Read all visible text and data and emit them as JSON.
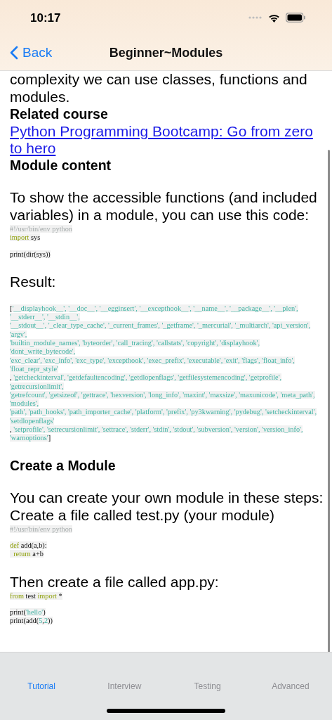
{
  "status_bar": {
    "time": "10:17"
  },
  "nav_bar": {
    "back": "Back",
    "title": "Beginner~Modules"
  },
  "sections": [
    {
      "blocks": [
        {
          "kind": "text",
          "text": "complexity we can use classes, functions and modules."
        },
        {
          "kind": "heading",
          "text": "Related course"
        },
        {
          "kind": "link",
          "text": "Python Programming Bootcamp: Go from zero to hero"
        },
        {
          "kind": "heading",
          "text": "Module content"
        }
      ]
    },
    {
      "blocks": [
        {
          "kind": "text",
          "text": "To show the accessible functions (and included variables) in a module, you can use this code:"
        },
        {
          "kind": "code",
          "groups": [
            [
              [
                {
                  "kind": "comment",
                  "text": "#!/usr/bin/env python"
                }
              ],
              [
                {
                  "kind": "keyword",
                  "text": "import"
                },
                {
                  "kind": "plain",
                  "text": " sys"
                }
              ]
            ],
            [
              [
                {
                  "kind": "plain",
                  "text": "print(dir(sys))"
                }
              ]
            ]
          ]
        }
      ]
    },
    {
      "blocks": [
        {
          "kind": "text",
          "text": "Result:"
        }
      ]
    },
    {
      "blocks": [
        {
          "kind": "code",
          "groups": [
            [
              [
                {
                  "kind": "plain",
                  "text": "["
                },
                {
                  "kind": "string",
                  "text": "'__displayhook__', '__doc__', '__egginsert', '__excepthook__', '__name__', '__package__', '__plen',"
                }
              ],
              [
                {
                  "kind": "string",
                  "text": "'__stderr__', '__stdin__',"
                }
              ],
              [
                {
                  "kind": "string",
                  "text": "'__stdout__', '_clear_type_cache', '_current_frames', '_getframe', '_mercurial', '_multiarch', 'api_version',"
                }
              ],
              [
                {
                  "kind": "string",
                  "text": "'argv',"
                }
              ],
              [
                {
                  "kind": "string",
                  "text": "'builtin_module_names', 'byteorder', 'call_tracing', 'callstats', 'copyright', 'displayhook',"
                }
              ],
              [
                {
                  "kind": "string",
                  "text": "'dont_write_bytecode',"
                }
              ],
              [
                {
                  "kind": "string",
                  "text": "'exc_clear', 'exc_info', 'exc_type', 'excepthook', 'exec_prefix', 'executable', 'exit', 'flags', 'float_info',"
                }
              ],
              [
                {
                  "kind": "string",
                  "text": "'float_repr_style'"
                }
              ],
              [
                {
                  "kind": "plain",
                  "text": ", "
                },
                {
                  "kind": "string",
                  "text": "'getcheckinterval', 'getdefaultencoding', 'getdlopenflags', 'getfilesystemencoding', 'getprofile',"
                }
              ],
              [
                {
                  "kind": "string",
                  "text": "'getrecursionlimit',"
                }
              ],
              [
                {
                  "kind": "string",
                  "text": "'getrefcount', 'getsizeof', 'gettrace', 'hexversion', 'long_info', 'maxint', 'maxsize', 'maxunicode', 'meta_path',"
                }
              ],
              [
                {
                  "kind": "string",
                  "text": "'modules',"
                }
              ],
              [
                {
                  "kind": "string",
                  "text": "'path', 'path_hooks', 'path_importer_cache', 'platform', 'prefix', 'py3kwarning', 'pydebug', 'setcheckinterval',"
                }
              ],
              [
                {
                  "kind": "string",
                  "text": "'setdlopenflags'"
                }
              ],
              [
                {
                  "kind": "plain",
                  "text": ", "
                },
                {
                  "kind": "string",
                  "text": "'setprofile', 'setrecursionlimit', 'settrace', 'stderr', 'stdin', 'stdout', 'subversion', 'version', 'version_info',"
                }
              ],
              [
                {
                  "kind": "string",
                  "text": "'warnoptions'"
                },
                {
                  "kind": "plain",
                  "text": "]"
                }
              ]
            ]
          ]
        }
      ]
    },
    {
      "blocks": [
        {
          "kind": "heading",
          "text": "Create a Module"
        }
      ]
    },
    {
      "blocks": [
        {
          "kind": "text",
          "text": "You can create your own module in these steps:"
        },
        {
          "kind": "text",
          "text": "Create a file called test.py (your module)"
        },
        {
          "kind": "code",
          "groups": [
            [
              [
                {
                  "kind": "comment",
                  "text": "#!/usr/bin/env python"
                }
              ]
            ],
            [
              [
                {
                  "kind": "keyword",
                  "text": "def"
                },
                {
                  "kind": "plain",
                  "text": " add(a,b):"
                }
              ],
              [
                {
                  "kind": "keyword",
                  "text": "  return"
                },
                {
                  "kind": "plain",
                  "text": " a+b"
                }
              ]
            ]
          ]
        }
      ]
    },
    {
      "blocks": [
        {
          "kind": "text",
          "text": "Then create a file called app.py:"
        },
        {
          "kind": "code",
          "groups": [
            [
              [
                {
                  "kind": "keyword",
                  "text": "from"
                },
                {
                  "kind": "plain",
                  "text": " test "
                },
                {
                  "kind": "keyword",
                  "text": "import"
                },
                {
                  "kind": "plain",
                  "text": " *"
                }
              ]
            ],
            [
              [
                {
                  "kind": "plain",
                  "text": "print("
                },
                {
                  "kind": "string",
                  "text": "'hello'"
                },
                {
                  "kind": "plain",
                  "text": ")"
                }
              ],
              [
                {
                  "kind": "plain",
                  "text": "print(add("
                },
                {
                  "kind": "string",
                  "text": "5"
                },
                {
                  "kind": "plain",
                  "text": ","
                },
                {
                  "kind": "string",
                  "text": "2"
                },
                {
                  "kind": "plain",
                  "text": "))"
                }
              ]
            ]
          ]
        }
      ]
    }
  ],
  "tabs": [
    {
      "label": "Tutorial",
      "selected": true
    },
    {
      "label": "Interview",
      "selected": false
    },
    {
      "label": "Testing",
      "selected": false
    },
    {
      "label": "Advanced",
      "selected": false
    }
  ]
}
